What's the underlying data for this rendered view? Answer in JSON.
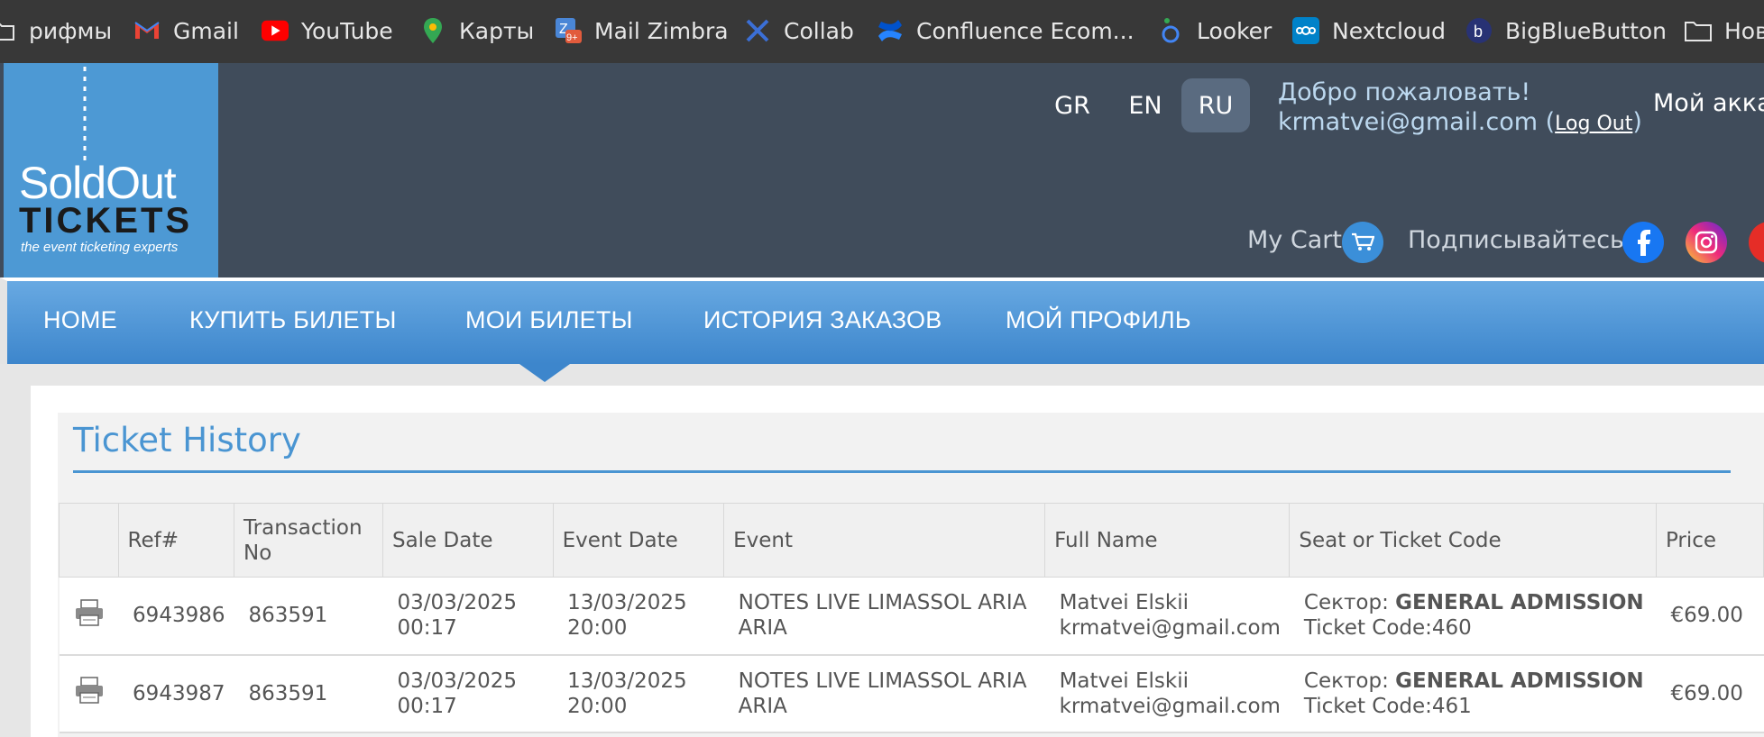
{
  "bookmarks": [
    {
      "label": "рифмы",
      "icon": "folder-icon"
    },
    {
      "label": "Gmail",
      "icon": "gmail-icon"
    },
    {
      "label": "YouTube",
      "icon": "youtube-icon"
    },
    {
      "label": "Карты",
      "icon": "maps-pin-icon"
    },
    {
      "label": "Mail Zimbra",
      "icon": "zimbra-icon",
      "badge": "9+"
    },
    {
      "label": "Collab",
      "icon": "collab-icon"
    },
    {
      "label": "Confluence Ecom...",
      "icon": "confluence-icon"
    },
    {
      "label": "Looker",
      "icon": "looker-icon"
    },
    {
      "label": "Nextcloud",
      "icon": "nextcloud-icon"
    },
    {
      "label": "BigBlueButton",
      "icon": "bigbluebutton-icon"
    },
    {
      "label": "Нов",
      "icon": "folder-icon"
    }
  ],
  "logo": {
    "line1": "SoldOut",
    "line2": "TICKETS",
    "tagline": "the event ticketing experts"
  },
  "languages": [
    {
      "code": "GR",
      "active": false
    },
    {
      "code": "EN",
      "active": false
    },
    {
      "code": "RU",
      "active": true
    }
  ],
  "user": {
    "welcome": "Добро пожаловать!",
    "email": "krmatvei@gmail.com",
    "logout": "Log Out",
    "account": "Мой акка"
  },
  "cart": {
    "label": "My Cart"
  },
  "subscribe": {
    "label": "Подписывайтесь"
  },
  "nav": {
    "items": [
      "HOME",
      "КУПИТЬ БИЛЕТЫ",
      "МОИ БИЛЕТЫ",
      "ИСТОРИЯ ЗАКАЗОВ",
      "МОЙ ПРОФИЛЬ"
    ],
    "active": "МОИ БИЛЕТЫ"
  },
  "ticket_history": {
    "title": "Ticket History",
    "columns": [
      "",
      "Ref#",
      "Transaction No",
      "Sale Date",
      "Event Date",
      "Event",
      "Full Name",
      "Seat or Ticket Code",
      "Price"
    ],
    "rows": [
      {
        "ref": "6943986",
        "transaction": "863591",
        "sale_date": "03/03/2025",
        "sale_time": "00:17",
        "event_date": "13/03/2025",
        "event_time": "20:00",
        "event": "NOTES LIVE LIMASSOL ARIA ARIA",
        "name": "Matvei Elskii",
        "email": "krmatvei@gmail.com",
        "sector_label": "Сектор:",
        "sector": "GENERAL ADMISSION",
        "ticket_code": "Ticket Code:460",
        "price": "€69.00"
      },
      {
        "ref": "6943987",
        "transaction": "863591",
        "sale_date": "03/03/2025",
        "sale_time": "00:17",
        "event_date": "13/03/2025",
        "event_time": "20:00",
        "event": "NOTES LIVE LIMASSOL ARIA ARIA",
        "name": "Matvei Elskii",
        "email": "krmatvei@gmail.com",
        "sector_label": "Сектор:",
        "sector": "GENERAL ADMISSION",
        "ticket_code": "Ticket Code:461",
        "price": "€69.00"
      }
    ]
  },
  "colors": {
    "bookmarks_bg": "#383838",
    "header_bg": "#404c5b",
    "logo_bg": "#4d99d4",
    "nav_blue": "#4a95d2",
    "facebook": "#1877f2",
    "instagram": "#e1306c"
  }
}
